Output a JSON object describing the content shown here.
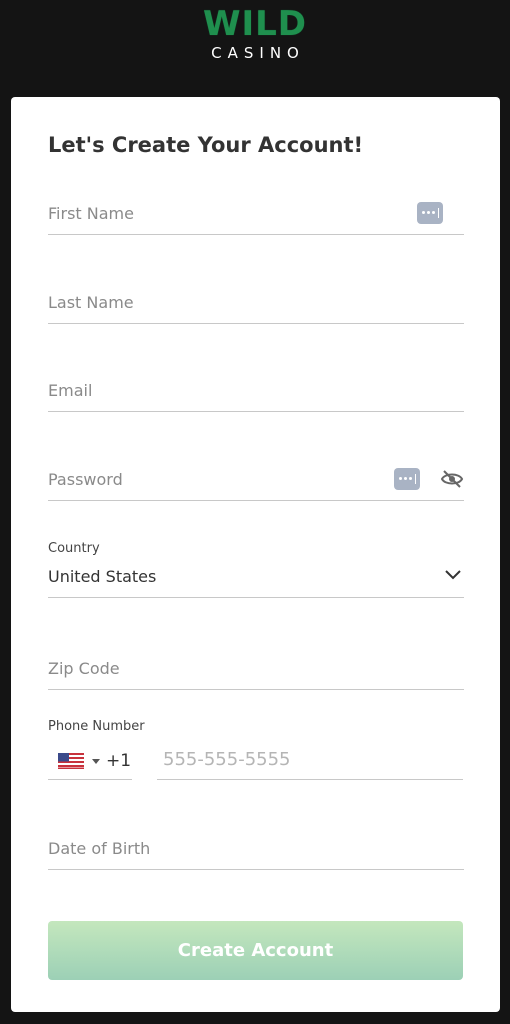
{
  "brand": {
    "name": "WILD",
    "sub": "CASINO",
    "primary_color": "#1f8f4e"
  },
  "form": {
    "title": "Let's Create Your Account!",
    "first_name_placeholder": "First Name",
    "last_name_placeholder": "Last Name",
    "email_placeholder": "Email",
    "password_placeholder": "Password",
    "country_label": "Country",
    "country_value": "United States",
    "zip_placeholder": "Zip Code",
    "phone_label": "Phone Number",
    "phone_dial_code": "+1",
    "phone_placeholder": "555-555-5555",
    "dob_placeholder": "Date of Birth",
    "submit_label": "Create Account",
    "submit_gradient": [
      "#c4e7bd",
      "#9cd0b6"
    ]
  },
  "icons": {
    "password_manager": "dots-key-icon",
    "toggle_password": "eye-slash-icon",
    "dropdown": "chevron-down-icon",
    "country_flag": "us-flag-icon"
  }
}
